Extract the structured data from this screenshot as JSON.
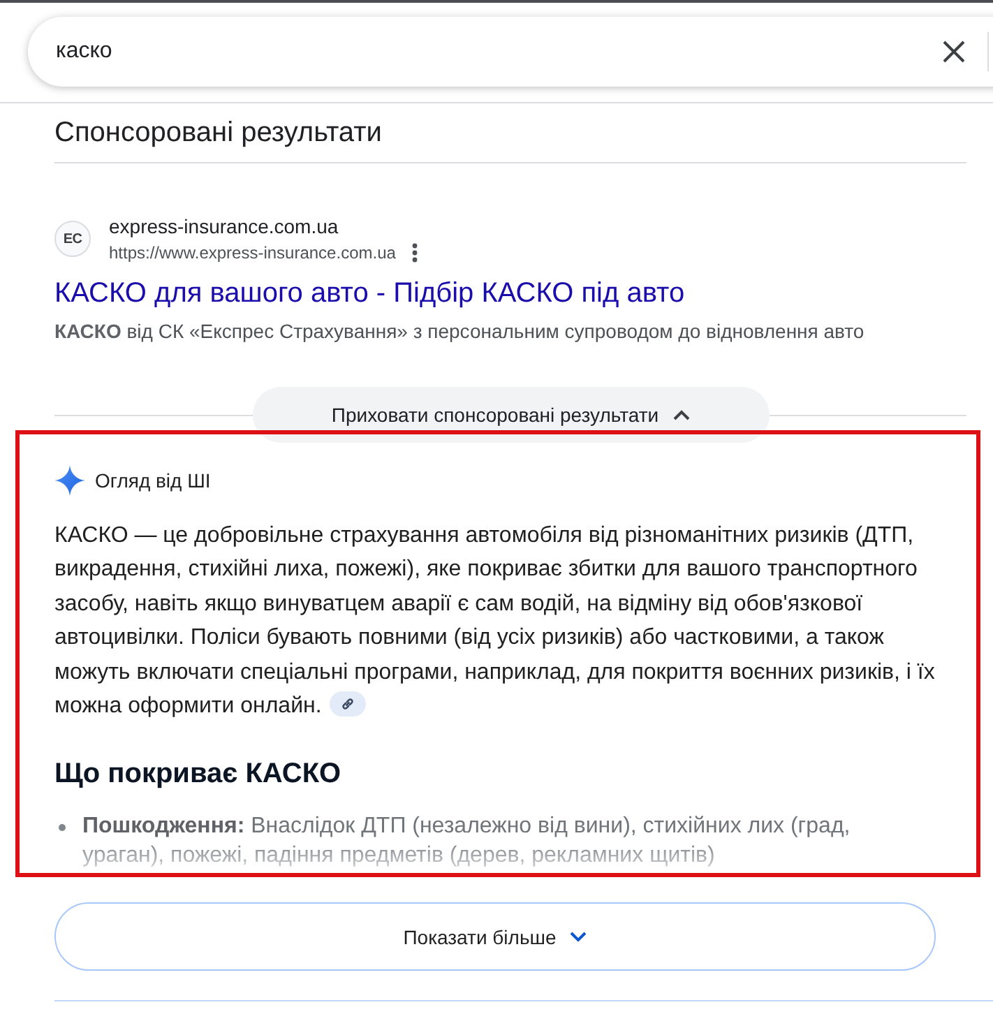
{
  "search": {
    "value": "каско"
  },
  "sponsored": {
    "heading": "Спонсоровані результати",
    "ad": {
      "favicon_text": "EC",
      "site_name": "express-insurance.com.ua",
      "url": "https://www.express-insurance.com.ua",
      "title": "КАСКО для вашого авто - Підбір КАСКО під авто",
      "description": "**КАСКО** від СК «Експрес Страхування» з персональним супроводом до відновлення авто"
    },
    "toggle": {
      "label": "Приховати спонсоровані результати",
      "expanded": true
    }
  },
  "ai_overview": {
    "highlighted": true,
    "label": "Огляд від ШІ",
    "summary": "КАСКО — це добровільне страхування автомобіля від різноманітних ризиків (ДТП, викрадення, стихійні лиха, пожежі), яке покриває збитки для вашого транспортного засобу, навіть якщо винуватцем аварії є сам водій, на відміну від обов'язкової автоцивілки. Поліси бувають повними (від усіх ризиків) або частковими, а також можуть включати спеціальні програми, наприклад, для покриття воєнних ризиків, і їх можна оформити онлайн.",
    "section_heading": "Що покриває КАСКО",
    "bullets": [
      {
        "text": "**Пошкодження:** Внаслідок ДТП (незалежно від вини), стихійних лих (град, ураган), пожежі, падіння предметів (дерев, рекламних щитів)"
      }
    ],
    "show_more": {
      "label": "Показати більше",
      "expanded": false
    }
  }
}
